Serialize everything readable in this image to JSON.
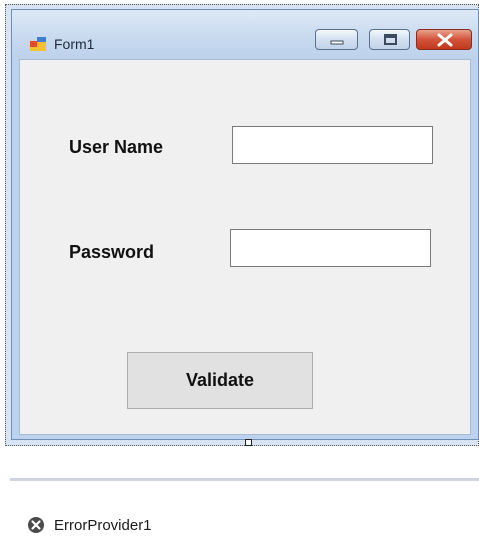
{
  "window": {
    "title": "Form1",
    "icon": "winform-icon",
    "controls": {
      "minimize_icon": "minimize-icon",
      "maximize_icon": "maximize-icon",
      "close_icon": "close-icon"
    },
    "close_color": "#c8452b"
  },
  "form": {
    "username_label": "User Name",
    "username_value": "",
    "password_label": "Password",
    "password_value": "",
    "validate_label": "Validate"
  },
  "component_tray": {
    "items": [
      {
        "icon": "error-provider-icon",
        "label": "ErrorProvider1"
      }
    ]
  }
}
